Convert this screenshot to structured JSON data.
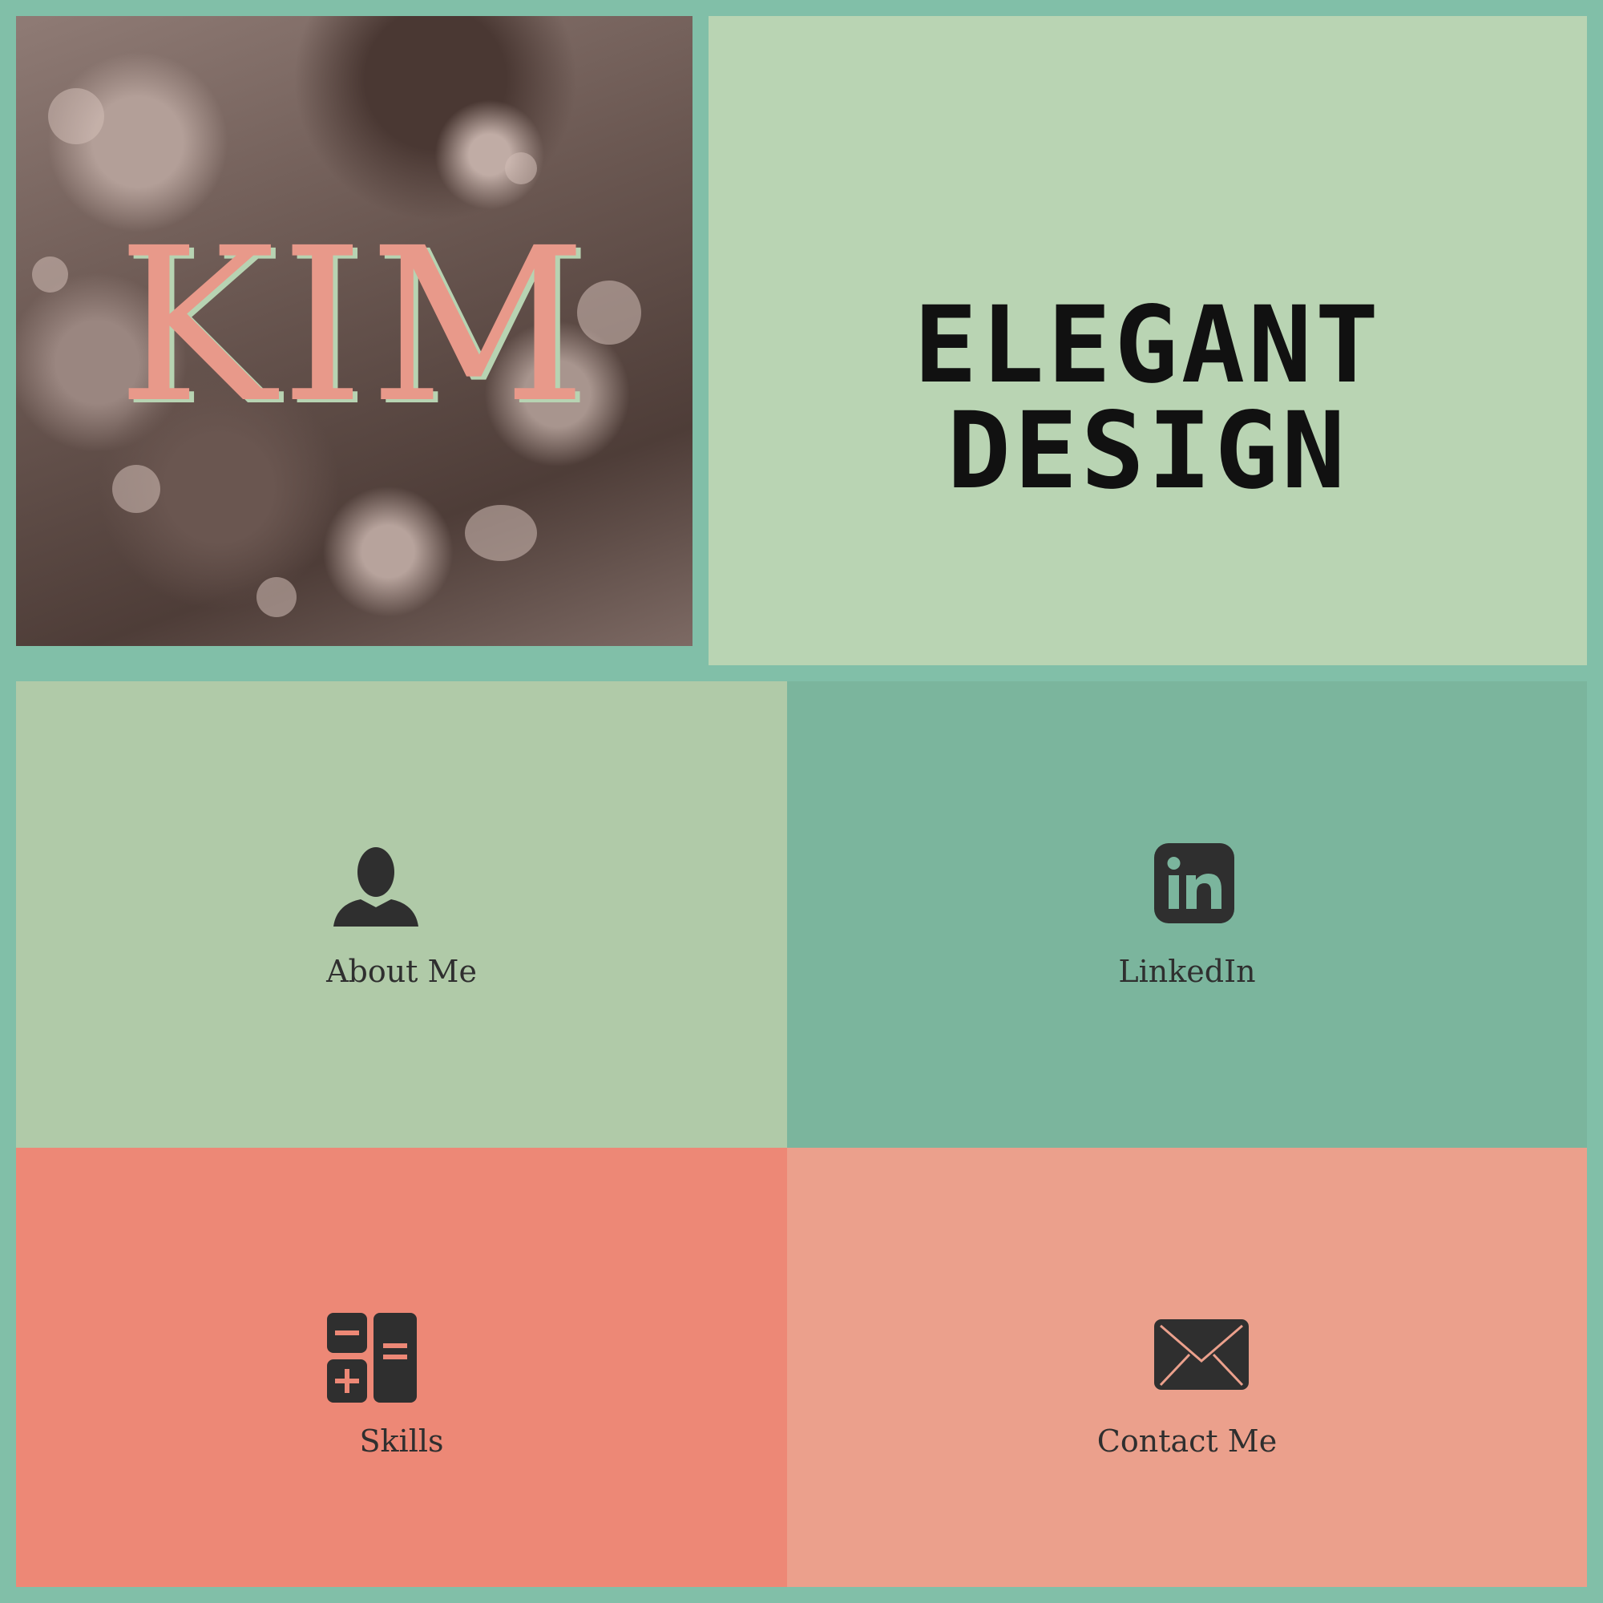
{
  "hero": {
    "name": "KIM",
    "icon": "flower-photo"
  },
  "brand": {
    "title": "ELEGANT DESIGN"
  },
  "tiles": [
    {
      "label": "About Me",
      "icon": "person-icon"
    },
    {
      "label": "LinkedIn",
      "icon": "linkedin-icon"
    },
    {
      "label": "Skills",
      "icon": "calculator-icon"
    },
    {
      "label": "Contact Me",
      "icon": "envelope-icon"
    }
  ],
  "colors": {
    "page_bg": "#81bfa8",
    "brand_bg": "#b9d4b3",
    "about_bg": "#b0caa8",
    "linkedin_bg": "#7bb59d",
    "skills_bg": "#ed8876",
    "contact_bg": "#eba08c",
    "name_color": "#e8998a",
    "icon_color": "#2f2f2f"
  }
}
